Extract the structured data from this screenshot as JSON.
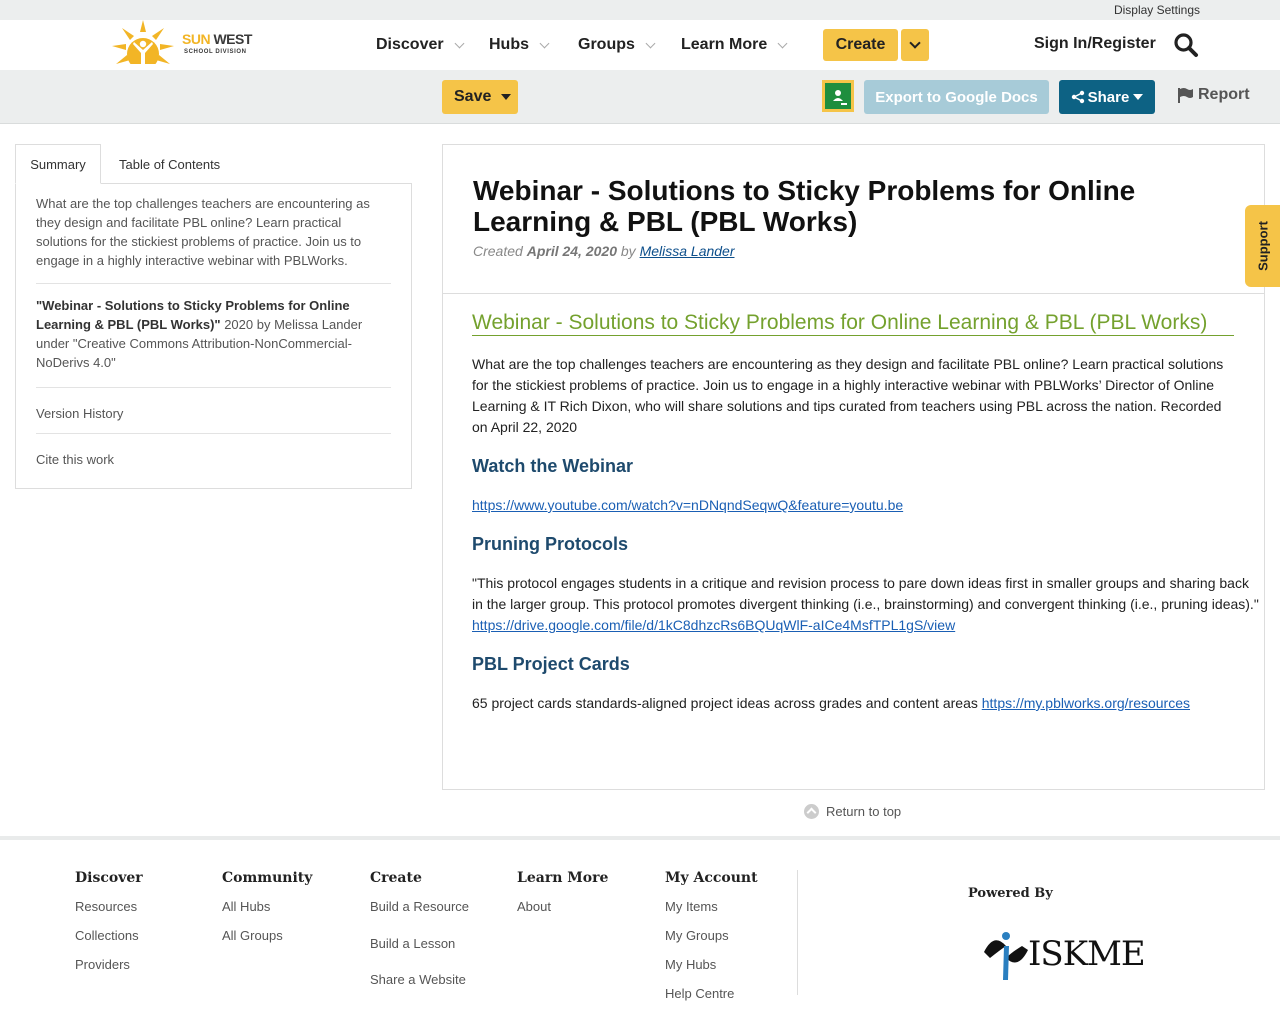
{
  "utility": {
    "display_settings": "Display Settings"
  },
  "header": {
    "logo": {
      "line1a": "SUN",
      "line1b": "WEST",
      "line2": "SCHOOL DIVISION"
    },
    "nav": [
      {
        "label": "Discover"
      },
      {
        "label": "Hubs"
      },
      {
        "label": "Groups"
      },
      {
        "label": "Learn More"
      }
    ],
    "create_label": "Create",
    "signin_label": "Sign In/Register"
  },
  "toolbar": {
    "save_label": "Save",
    "export_label": "Export to Google Docs",
    "share_label": "Share",
    "report_label": "Report"
  },
  "left": {
    "tabs": {
      "summary": "Summary",
      "toc": "Table of Contents"
    },
    "summary_text": "What are the top challenges teachers are encountering as they design and facilitate PBL online? Learn practical solutions for the stickiest problems of practice. Join us to engage in a highly interactive webinar with PBLWorks.",
    "attribution": {
      "title": "\"Webinar - Solutions to Sticky Problems for Online Learning & PBL (PBL Works)\"",
      "rest": " 2020 by Melissa Lander under \"Creative Commons Attribution-NonCommercial-NoDerivs 4.0\""
    },
    "version_history": "Version History",
    "cite": "Cite this work"
  },
  "main": {
    "title": "Webinar - Solutions to Sticky Problems for Online Learning & PBL (PBL Works)",
    "meta": {
      "created": "Created",
      "date": "April 24, 2020",
      "by": "by",
      "author": "Melissa Lander"
    },
    "res_title": "Webinar - Solutions to Sticky Problems for Online Learning & PBL (PBL Works)",
    "intro": "What are the top challenges teachers are encountering as they design and facilitate PBL online? Learn practical solutions for the stickiest problems of practice. Join us to engage in a highly interactive webinar with PBLWorks’ Director of Online Learning & IT Rich Dixon, who will share solutions and tips curated from teachers using PBL across the nation.  Recorded on April 22, 2020",
    "h_webinar": "Watch the Webinar",
    "webinar_link": "https://www.youtube.com/watch?v=nDNqndSeqwQ&feature=youtu.be",
    "h_pruning": "Pruning Protocols",
    "pruning_text": "\"This protocol engages students in a critique and revision process to pare down ideas first in smaller groups and sharing back in the larger group. This protocol promotes divergent thinking (i.e., brainstorming) and convergent thinking (i.e., pruning ideas).\" ",
    "pruning_link": "https://drive.google.com/file/d/1kC8dhzcRs6BQUqWlF-aICe4MsfTPL1gS/view",
    "h_cards": "PBL Project Cards",
    "cards_text": "65 project cards standards-aligned project ideas across grades and content areas ",
    "cards_link": "https://my.pblworks.org/resources"
  },
  "return_top": "Return to top",
  "support": "Support",
  "footer": {
    "discover": {
      "heading": "Discover",
      "items": [
        "Resources",
        "Collections",
        "Providers"
      ]
    },
    "community": {
      "heading": "Community",
      "items": [
        "All Hubs",
        "All Groups"
      ]
    },
    "create": {
      "heading": "Create",
      "items": [
        "Build a Resource",
        "Build a Lesson",
        "Share a Website"
      ]
    },
    "learn": {
      "heading": "Learn More",
      "items": [
        "About"
      ]
    },
    "account": {
      "heading": "My Account",
      "items": [
        "My Items",
        "My Groups",
        "My Hubs",
        "Help Centre"
      ]
    },
    "powered_by": "Powered By",
    "iskme": "ISKME"
  },
  "colors": {
    "accent_yellow": "#f5c448",
    "share_blue": "#0d6284",
    "title_green": "#74a12e",
    "heading_blue": "#1e4a6d"
  }
}
